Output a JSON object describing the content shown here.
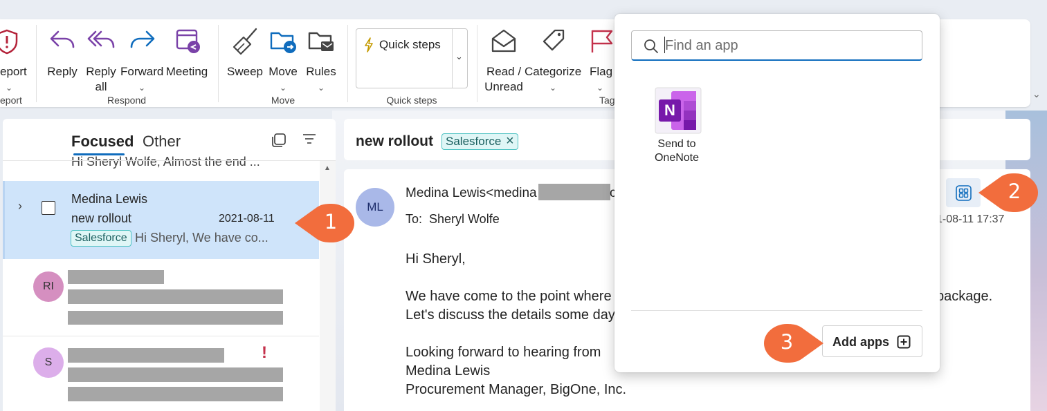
{
  "ribbon": {
    "report": {
      "label": "eport",
      "group": "eport"
    },
    "respond": {
      "group": "Respond",
      "reply": "Reply",
      "reply_all_1": "Reply",
      "reply_all_2": "all",
      "forward": "Forward",
      "meeting": "Meeting"
    },
    "move": {
      "group": "Move",
      "sweep": "Sweep",
      "move": "Move",
      "rules": "Rules"
    },
    "quick_steps": {
      "group": "Quick steps",
      "label": "Quick steps"
    },
    "tags": {
      "group": "Tag",
      "read_unread_1": "Read /",
      "read_unread_2": "Unread",
      "categorize": "Categorize",
      "flag": "Flag"
    }
  },
  "message_list": {
    "tabs": [
      "Focused",
      "Other"
    ],
    "cut_preview": "Hi Sheryl Wolfe, Almost the end ...",
    "selected": {
      "sender": "Medina Lewis",
      "subject": "new rollout",
      "date": "2021-08-11",
      "tag": "Salesforce",
      "preview": "Hi Sheryl, We have co..."
    },
    "rows": [
      {
        "initials": "RI",
        "color": "#d58fc0"
      },
      {
        "initials": "S",
        "color": "#dcaeea",
        "important": "!"
      }
    ]
  },
  "reading_pane": {
    "subject": "new rollout",
    "tag": "Salesforce",
    "sender_initials": "ML",
    "sender_display": "Medina Lewis<medina",
    "sender_tail": "c",
    "to_label": "To:",
    "to_name": "Sheryl Wolfe",
    "date": "1-08-11 17:37",
    "body": [
      "Hi Sheryl,",
      "We have come to the point where",
      "Let's discuss the details some day",
      "Looking forward to hearing from",
      "Medina Lewis",
      "Procurement Manager, BigOne, Inc."
    ],
    "body_tail": "package."
  },
  "apps_popup": {
    "search_placeholder": "Find an app",
    "apps": [
      {
        "name_1": "Send to",
        "name_2": "OneNote",
        "icon_letter": "N"
      }
    ],
    "add_apps_label": "Add apps"
  },
  "callouts": [
    "1",
    "2",
    "3"
  ],
  "colors": {
    "accent": "#0f6cbd",
    "callout": "#f26d3d",
    "selected_row": "#cfe4fa",
    "onenote": "#7719aa",
    "flag": "#c4314b",
    "important": "#c4314b"
  }
}
